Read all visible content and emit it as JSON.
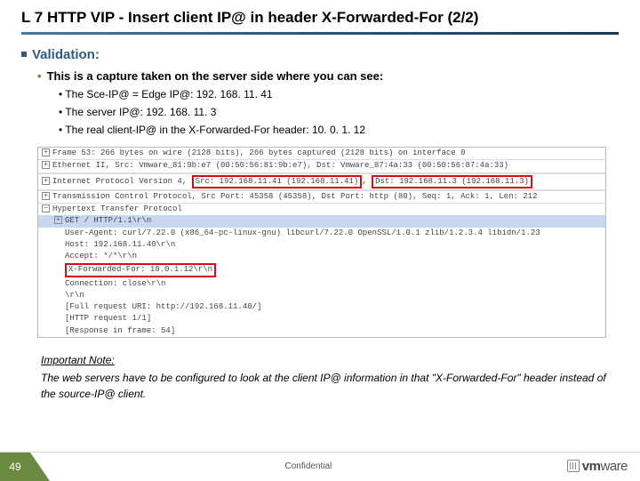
{
  "title": "L 7 HTTP VIP - Insert client IP@ in header X-Forwarded-For (2/2)",
  "section": "Validation:",
  "intro": "This is a capture taken on the server side where you can see:",
  "bullets": [
    "The Sce-IP@ = Edge IP@: 192. 168. 11. 41",
    "The server IP@: 192. 168. 11. 3",
    "The real client-IP@ in the X-Forwarded-For header: 10. 0. 1. 12"
  ],
  "capture": {
    "l1": "Frame 53: 266 bytes on wire (2128 bits), 266 bytes captured (2128 bits) on interface 0",
    "l2a": "Ethernet II, Src: Vmware_81:9b:e7 (00:50:56:81:9b:e7), Dst: Vmware_87:4a:33 (00:50:56:87:4a:33)",
    "l3a": "Internet Protocol Version 4, ",
    "l3b": "Src: 192.168.11.41 (192.168.11.41)",
    "l3c": ", ",
    "l3d": "Dst: 192.168.11.3 (192.168.11.3)",
    "l4": "Transmission Control Protocol, Src Port: 45358 (45358), Dst Port: http (80), Seq: 1, Ack: 1, Len: 212",
    "l5": "Hypertext Transfer Protocol",
    "l6": "GET / HTTP/1.1\\r\\n",
    "l7": "User-Agent: curl/7.22.0 (x86_64-pc-linux-gnu) libcurl/7.22.0 OpenSSL/1.0.1 zlib/1.2.3.4 libidn/1.23",
    "l8": "Host: 192.168.11.40\\r\\n",
    "l9": "Accept: */*\\r\\n",
    "l10": "X-Forwarded-For: 10.0.1.12\\r\\n",
    "l11": "Connection: close\\r\\n",
    "l12": "\\r\\n",
    "l13": "[Full request URI: http://192.168.11.40/]",
    "l14": "[HTTP request 1/1]",
    "l15": "[Response in frame: 54]"
  },
  "note_heading": "Important Note:",
  "note_body": "The web servers have to be configured to look at the client IP@ information in that \"X-Forwarded-For\" header instead of the source-IP@ client.",
  "footer": {
    "page": "49",
    "confidential": "Confidential",
    "logo_pre": "vm",
    "logo_post": "ware"
  }
}
